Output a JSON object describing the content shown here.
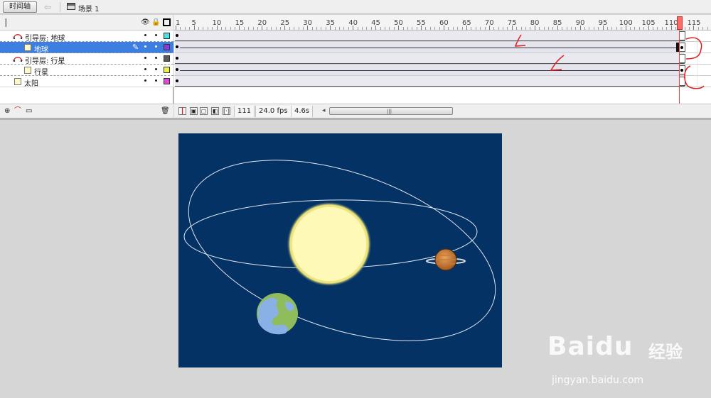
{
  "toolbar": {
    "timeline_button": "时间轴",
    "scene_label": "场景 1"
  },
  "layers": [
    {
      "name": "引导层: 地球",
      "type": "guide",
      "color": "#48e0e0",
      "selected": false
    },
    {
      "name": "地球",
      "type": "normal",
      "color": "#8a3cd8",
      "selected": true
    },
    {
      "name": "引导层: 行星",
      "type": "guide",
      "color": "#5a5a5a",
      "selected": false
    },
    {
      "name": "行星",
      "type": "normal",
      "color": "#f0f04a",
      "selected": false
    },
    {
      "name": "太阳",
      "type": "normal",
      "color": "#e048d8",
      "selected": false
    }
  ],
  "ruler": {
    "labels": [
      "1",
      "5",
      "10",
      "15",
      "20",
      "25",
      "30",
      "35",
      "40",
      "45",
      "50",
      "55",
      "60",
      "65",
      "70",
      "75",
      "80",
      "85",
      "90",
      "95",
      "100",
      "105",
      "110",
      "115"
    ],
    "current_frame": 111
  },
  "status": {
    "frame": "111",
    "fps": "24.0 fps",
    "time": "4.6s"
  },
  "stage": {
    "background": "#043264"
  },
  "watermark": {
    "brand": "Baidu",
    "brand_cn": "经验",
    "url": "jingyan.baidu.com"
  }
}
